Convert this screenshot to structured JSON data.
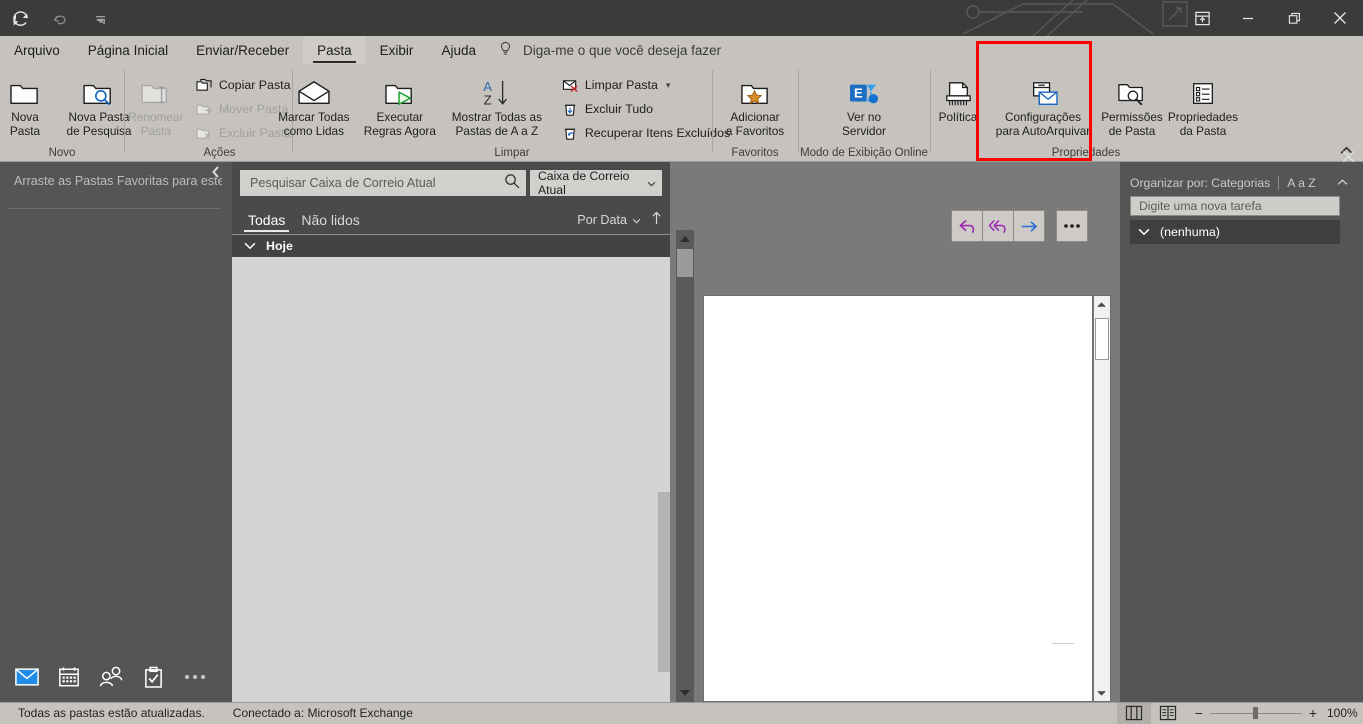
{
  "titlebar": {
    "quick_access": [
      {
        "name": "send-receive-all-icon",
        "label": "Enviar/Receber Todas as Pastas"
      },
      {
        "name": "undo-icon",
        "label": "Desfazer"
      },
      {
        "name": "customize-qat-icon",
        "label": "Personalizar Barra de Ferramentas de Acesso Rápido"
      }
    ],
    "window_controls": [
      {
        "name": "ribbon-display-options-icon",
        "label": "Opções de Exibição da Faixa de Opções"
      },
      {
        "name": "minimize-icon",
        "label": "Minimizar"
      },
      {
        "name": "restore-icon",
        "label": "Restaurar Abaixo"
      },
      {
        "name": "close-icon",
        "label": "Fechar"
      }
    ]
  },
  "ribbon": {
    "tabs": [
      {
        "label": "Arquivo",
        "active": false
      },
      {
        "label": "Página Inicial",
        "active": false
      },
      {
        "label": "Enviar/Receber",
        "active": false
      },
      {
        "label": "Pasta",
        "active": true
      },
      {
        "label": "Exibir",
        "active": false
      },
      {
        "label": "Ajuda",
        "active": false
      }
    ],
    "tell_me": "Diga-me o que você deseja fazer",
    "collapse_label": "Recolher a Faixa de Opções",
    "groups": [
      {
        "title": "Novo",
        "buttons": [
          {
            "label": "Nova\nPasta",
            "icon": "new-folder-icon",
            "disabled": false
          },
          {
            "label": "Nova Pasta\nde Pesquisa",
            "icon": "new-search-folder-icon",
            "disabled": false
          }
        ]
      },
      {
        "title": "Ações",
        "buttons": [
          {
            "label": "Renomear\nPasta",
            "icon": "rename-folder-icon",
            "disabled": true
          }
        ],
        "small_buttons": [
          {
            "label": "Copiar Pasta",
            "icon": "copy-folder-icon",
            "disabled": false
          },
          {
            "label": "Mover Pasta",
            "icon": "move-folder-icon",
            "disabled": true
          },
          {
            "label": "Excluir Pasta",
            "icon": "delete-folder-icon",
            "disabled": true
          }
        ]
      },
      {
        "title": "Limpar",
        "buttons": [
          {
            "label": "Marcar Todas\ncomo Lidas",
            "icon": "mark-all-read-icon",
            "disabled": false
          },
          {
            "label": "Executar\nRegras Agora",
            "icon": "run-rules-now-icon",
            "disabled": false
          },
          {
            "label": "Mostrar Todas as\nPastas de A a Z",
            "icon": "sort-folders-az-icon",
            "disabled": false
          }
        ],
        "small_buttons": [
          {
            "label": "Limpar Pasta",
            "icon": "clean-up-folder-icon",
            "disabled": false,
            "has_dropdown": true
          },
          {
            "label": "Excluir Tudo",
            "icon": "delete-all-icon",
            "disabled": false
          },
          {
            "label": "Recuperar Itens Excluídos",
            "icon": "recover-deleted-items-icon",
            "disabled": false
          }
        ]
      },
      {
        "title": "Favoritos",
        "buttons": [
          {
            "label": "Adicionar\na Favoritos",
            "icon": "add-to-favorites-icon",
            "disabled": false
          }
        ]
      },
      {
        "title": "Modo de Exibição Online",
        "buttons": [
          {
            "label": "Ver no\nServidor",
            "icon": "exchange-view-on-server-icon",
            "disabled": false
          }
        ]
      },
      {
        "title": "Propriedades",
        "buttons": [
          {
            "label": "Política",
            "icon": "policy-icon",
            "disabled": false
          },
          {
            "label": "Configurações\npara AutoArquivar",
            "icon": "autoarchive-settings-icon",
            "disabled": false,
            "highlighted": true
          },
          {
            "label": "Permissões\nde Pasta",
            "icon": "folder-permissions-icon",
            "disabled": false
          },
          {
            "label": "Propriedades\nda Pasta",
            "icon": "folder-properties-icon",
            "disabled": false
          }
        ]
      }
    ]
  },
  "folder_pane": {
    "favorites_hint": "Arraste as Pastas Favoritas para este Local",
    "collapse_icon": "collapse-folder-pane-icon",
    "nav_items": [
      {
        "name": "nav-mail-icon",
        "label": "Email"
      },
      {
        "name": "nav-calendar-icon",
        "label": "Calendário"
      },
      {
        "name": "nav-people-icon",
        "label": "Pessoas"
      },
      {
        "name": "nav-tasks-icon",
        "label": "Tarefas"
      },
      {
        "name": "nav-more-icon",
        "label": "Mais"
      }
    ]
  },
  "message_list": {
    "search_placeholder": "Pesquisar Caixa de Correio Atual",
    "search_icon": "search-icon",
    "scope_value": "Caixa de Correio Atual",
    "filters": [
      {
        "label": "Todas",
        "active": true
      },
      {
        "label": "Não lidos",
        "active": false
      }
    ],
    "sort_label": "Por Data",
    "sort_direction_icon": "arrow-up-icon",
    "group_header": "Hoje",
    "items": []
  },
  "reading_pane": {
    "actions": [
      {
        "name": "reply-button",
        "label": "Responder",
        "icon": "reply-icon"
      },
      {
        "name": "reply-all-button",
        "label": "Responder a Todos",
        "icon": "reply-all-icon"
      },
      {
        "name": "forward-button",
        "label": "Encaminhar",
        "icon": "forward-icon"
      },
      {
        "name": "more-actions-button",
        "label": "Mais",
        "icon": "ellipsis-icon"
      }
    ]
  },
  "task_pane": {
    "arrange_by": "Organizar por: Categorias",
    "sort_az": "A a Z",
    "new_task_placeholder": "Digite uma nova tarefa",
    "group_label": "(nenhuma)",
    "close_icon": "close-icon"
  },
  "status_bar": {
    "sync_status": "Todas as pastas estão atualizadas.",
    "connection_status": "Conectado a: Microsoft Exchange",
    "view_buttons": [
      {
        "name": "normal-view-button",
        "label": "Normal",
        "selected": true
      },
      {
        "name": "reading-view-button",
        "label": "Leitura",
        "selected": false
      }
    ],
    "zoom_out": "−",
    "zoom_in": "+",
    "zoom_level": "100%"
  },
  "colors": {
    "titlebar_bg": "#3b3b3b",
    "ribbon_bg": "#c6c3bf",
    "pane_bg": "#555555",
    "list_bg": "#d4d4d4",
    "highlight": "#ff0000",
    "accent_blue": "#0f6cbd"
  }
}
